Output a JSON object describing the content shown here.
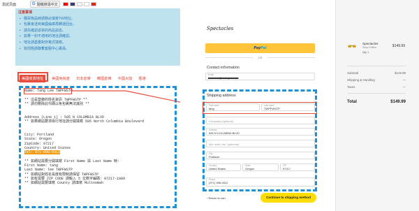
{
  "left": {
    "breadcrumb": "測試頁面",
    "search_label": "隨機搜尋中文",
    "notes_title": "注意事項",
    "notes": [
      "購買物品時請務必填寫TW地址。",
      "包裹會送到美國倫庫再轉運回台。",
      "請先確認返來的商品訓息。",
      "如果一封不適用的地址請確認。",
      "地址請盡量對齊格式填寫。",
      "有問題請聯繫客服中心專員。"
    ],
    "tabs": [
      "美國收貨地址",
      "美國免稅倉",
      "日本倉庫",
      "韓國倉庫",
      "中國大陸",
      "香港"
    ],
    "address_lines": [
      "Name: Tang Lee TWPFWSTP",
      "",
      "** 這是登錄的姓名資訊 TWPFWSTP **",
      "** 請勿刪除此代碼以免包裹無法識別 **",
      "",
      "",
      "Address (Line 1) : 595 N COLUMBIA BLVD",
      "** 如果網站要求兩行地址請分開填寫 595 North Columbia Boulevard",
      "",
      "",
      "City: Portland",
      "State: Oregon",
      "ZipCode: 97217",
      "Country: United States",
      "Tel: 971-998-9312",
      "",
      "** 如網站需要分開填寫 First Name 與 Last Name 時:",
      "First Name: tang",
      "Last Name: lee TWPFWSTP",
      "** 如網站對姓名長度有限制請保留 TWPFWSTP",
      "** 如有需要 ZIP CODE 請輸入 5 位數字編碼: 97217-1089",
      "** 如網站需要填寫 County 請填寫 Multnomah"
    ]
  },
  "checkout": {
    "brand": "Spectacles",
    "paypal_pay": "Pay",
    "paypal_pal": "Pal",
    "or_label": "OR",
    "contact_heading": "Contact information",
    "email_label": "Email",
    "email_value": "redacted@example.com",
    "shipping_heading": "Shipping address",
    "first_name_label": "First name",
    "first_name_value": "tang",
    "last_name_label": "Last name",
    "last_name_value": "TWPFWSTP",
    "company_placeholder": "Company (optional)",
    "address_label": "Address",
    "address_value": "595 N COLUMBIA BLVD",
    "apt_placeholder": "Apt, suite, etc. (optional)",
    "city_label": "City",
    "city_value": "Portland",
    "country_label": "Country",
    "country_value": "United States",
    "state_label": "State",
    "state_value": "Oregon",
    "zip_label": "ZIP",
    "zip_value": "97217",
    "phone_label": "Phone",
    "phone_value": "(971) 998-9312",
    "back_label": "‹ Return to cart",
    "continue_label": "Continue to shipping method"
  },
  "summary": {
    "product_name": "Spectacles",
    "product_sub": "Shop Edition",
    "product_qty": "Qty 1",
    "product_price": "$149.99",
    "subtotal_label": "Subtotal",
    "subtotal_value": "$149.99",
    "shipping_label": "Shipping & Handling",
    "shipping_value": "—",
    "taxes_label": "Taxes",
    "taxes_value": "—",
    "total_label": "Total",
    "total_value": "$149.99"
  },
  "colors": {
    "accent_red": "#e74c3c",
    "accent_blue": "#1e90d6",
    "paypal_yellow": "#ffc439",
    "continue_yellow": "#ffdd00"
  }
}
